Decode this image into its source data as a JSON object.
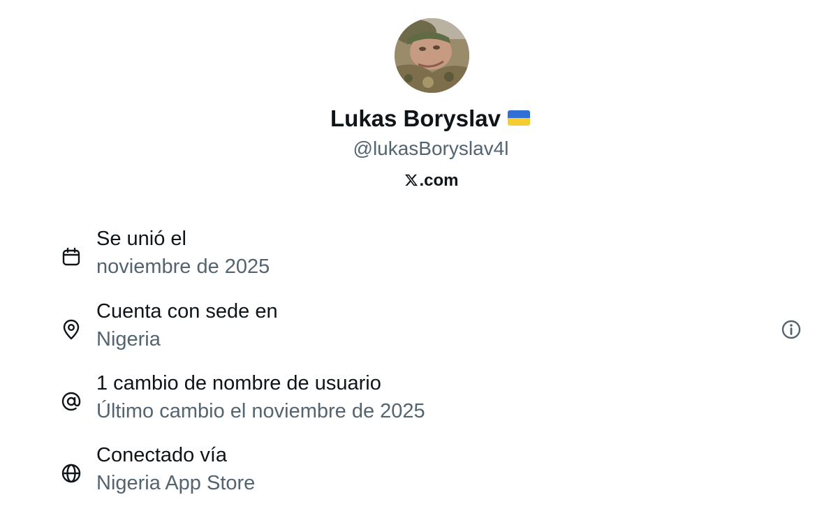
{
  "profile": {
    "display_name": "Lukas Boryslav",
    "name_flag": "ukraine-flag-icon",
    "handle": "@lukasBoryslav4l",
    "site_suffix": ".com",
    "site_logo": "x-logo-icon"
  },
  "about": {
    "rows": [
      {
        "icon": "calendar-icon",
        "title": "Se unió el",
        "subtitle": "noviembre de 2025"
      },
      {
        "icon": "location-pin-icon",
        "title": "Cuenta con sede en",
        "subtitle": "Nigeria",
        "trailing_icon": "info-icon"
      },
      {
        "icon": "at-sign-icon",
        "title": "1 cambio de nombre de usuario",
        "subtitle": "Último cambio el noviembre de 2025"
      },
      {
        "icon": "globe-icon",
        "title": "Conectado vía",
        "subtitle": "Nigeria App Store"
      }
    ]
  },
  "colors": {
    "primary_text": "#0f1419",
    "secondary_text": "#536471",
    "background": "#ffffff",
    "flag_blue": "#2f6fd6",
    "flag_yellow": "#f5cd32"
  }
}
